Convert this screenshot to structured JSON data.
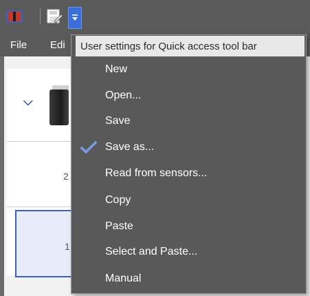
{
  "menubar": {
    "file": "File",
    "edit": "Edi"
  },
  "quick_access": {
    "dropdown_title": "User settings for Quick access tool bar",
    "items": [
      {
        "label": "New",
        "checked": false
      },
      {
        "label": "Open...",
        "checked": false
      },
      {
        "label": "Save",
        "checked": false
      },
      {
        "label": "Save as...",
        "checked": true
      },
      {
        "label": "Read from sensors...",
        "checked": false
      },
      {
        "label": "Copy",
        "checked": false
      },
      {
        "label": "Paste",
        "checked": false
      },
      {
        "label": "Select and Paste...",
        "checked": false
      },
      {
        "label": "Manual",
        "checked": false
      }
    ]
  },
  "background": {
    "row_number_a": "2",
    "row_number_b": "1"
  },
  "icons": {
    "app": "app-logo-icon",
    "save": "save-file-icon",
    "dropdown": "dropdown-arrow-icon",
    "expand": "chevron-down-icon",
    "check": "checkmark-icon"
  },
  "colors": {
    "toolbar_bg": "#5a5a5a",
    "menu_bg": "#595959",
    "accent": "#3b6fd8",
    "check": "#7b9be6"
  }
}
